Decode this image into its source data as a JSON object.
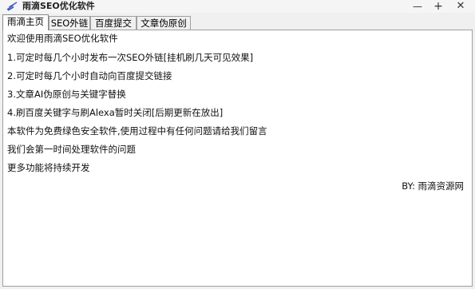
{
  "window": {
    "title": "雨滴SEO优化软件",
    "minimize_glyph": "—",
    "maximize_glyph": "+",
    "close_glyph": "✕",
    "icon": "app-icon"
  },
  "tabs": [
    {
      "label": "雨滴主页",
      "active": true
    },
    {
      "label": "SEO外链",
      "active": false
    },
    {
      "label": "百度提交",
      "active": false
    },
    {
      "label": "文章伪原创",
      "active": false
    }
  ],
  "main": {
    "lines": [
      "欢迎使用雨滴SEO优化软件",
      "1.可定时每几个小时发布一次SEO外链[挂机刷几天可见效果]",
      "2.可定时每几个小时自动向百度提交链接",
      "3.文章AI伪原创与关键字替换",
      "4.刷百度关键字与刷Alexa暂时关闭[后期更新在放出]",
      "本软件为免费绿色安全软件,使用过程中有任何问题请给我们留言",
      "我们会第一时间处理软件的问题",
      "更多功能将持续开发"
    ],
    "credit": "BY: 雨滴资源网"
  }
}
